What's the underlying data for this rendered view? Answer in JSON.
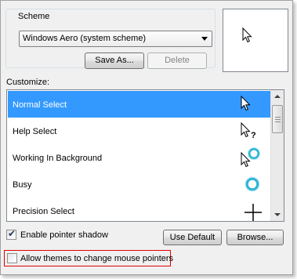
{
  "scheme": {
    "legend": "Scheme",
    "selected": "Windows Aero (system scheme)",
    "save_as_label": "Save As...",
    "delete_label": "Delete"
  },
  "customize": {
    "label": "Customize:",
    "items": [
      {
        "label": "Normal Select",
        "cursor_icon": "arrow-cursor-icon",
        "selected": true
      },
      {
        "label": "Help Select",
        "cursor_icon": "help-cursor-icon",
        "selected": false
      },
      {
        "label": "Working In Background",
        "cursor_icon": "working-cursor-icon",
        "selected": false
      },
      {
        "label": "Busy",
        "cursor_icon": "busy-cursor-icon",
        "selected": false
      },
      {
        "label": "Precision Select",
        "cursor_icon": "crosshair-cursor-icon",
        "selected": false
      }
    ]
  },
  "options": {
    "pointer_shadow_label": "Enable pointer shadow",
    "pointer_shadow_checked": true,
    "themes_label": "Allow themes to change mouse pointers",
    "themes_checked": false
  },
  "buttons": {
    "use_default_label": "Use Default",
    "browse_label": "Browse..."
  },
  "colors": {
    "selection": "#3399ff",
    "highlight_outline": "#e00000",
    "busy_ring": "#2fb6d6"
  }
}
